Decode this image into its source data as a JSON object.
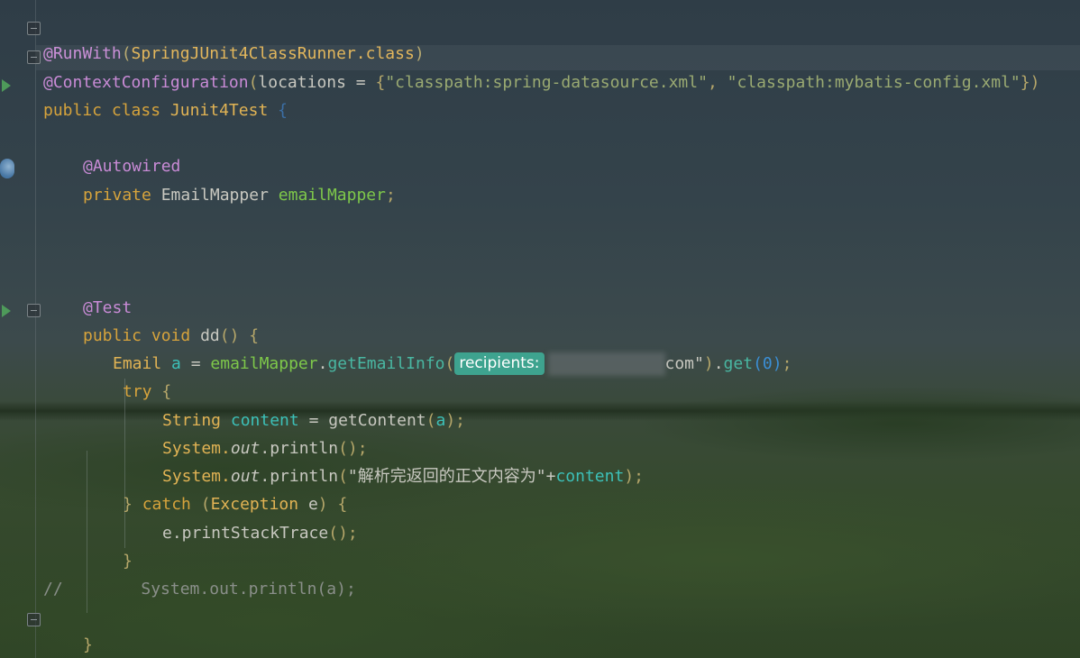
{
  "editor": {
    "line1": {
      "annotation": "@RunWith",
      "open": "(",
      "class_ref": "SpringJUnit4ClassRunner",
      "dot_class": ".class",
      "close": ")"
    },
    "line2": {
      "annotation": "@ContextConfiguration",
      "open": "(",
      "param": "locations",
      "eq": " = ",
      "brace_open": "{",
      "str1": "\"classpath:spring-datasource.xml\"",
      "comma": ", ",
      "str2": "\"classpath:mybatis-config.xml\"",
      "brace_close": "})"
    },
    "line3": {
      "kw1": "public",
      "kw2": "class",
      "name": "Junit4Test",
      "brace": "{"
    },
    "line4": {
      "annotation": "@Autowired"
    },
    "line5": {
      "kw": "private",
      "type": "EmailMapper",
      "field": "emailMapper",
      "semi": ";"
    },
    "line6": {
      "annotation": "@Test"
    },
    "line7": {
      "kw1": "public",
      "kw2": "void",
      "name": "dd",
      "parens": "()",
      "brace": "{"
    },
    "line8": {
      "type": "Email",
      "var": "a",
      "eq": " = ",
      "field": "emailMapper",
      "dot": ".",
      "method": "getEmailInfo",
      "open": "(",
      "hint": "recipients:",
      "redacted_suffix": "com\"",
      "close": ")",
      "dot2": ".",
      "method2": "get",
      "args": "(0)",
      "semi": ";"
    },
    "line9": {
      "kw": "try",
      "brace": "{"
    },
    "line10": {
      "type": "String",
      "var": "content",
      "eq": " = ",
      "method": "getContent",
      "open": "(",
      "arg": "a",
      "close": ")",
      "semi": ";"
    },
    "line11": {
      "cls": "System.",
      "field": "out",
      "rest": ".println",
      "parens": "()",
      "semi": ";"
    },
    "line12": {
      "cls": "System.",
      "field": "out",
      "rest": ".println",
      "open": "(",
      "str": "\"解析完返回的正文内容为\"",
      "plus": "+",
      "var": "content",
      "close": ")",
      "semi": ";"
    },
    "line13": {
      "close": "}",
      "kw": "catch",
      "open": "(",
      "type": "Exception",
      "var": "e",
      "close2": ")",
      "brace": "{"
    },
    "line14": {
      "text": "e.printStackTrace",
      "parens": "()",
      "semi": ";"
    },
    "line15": {
      "brace": "}"
    },
    "line16": {
      "comment": "//        System.out.println(a);"
    },
    "line17": {
      "brace": "}"
    }
  }
}
